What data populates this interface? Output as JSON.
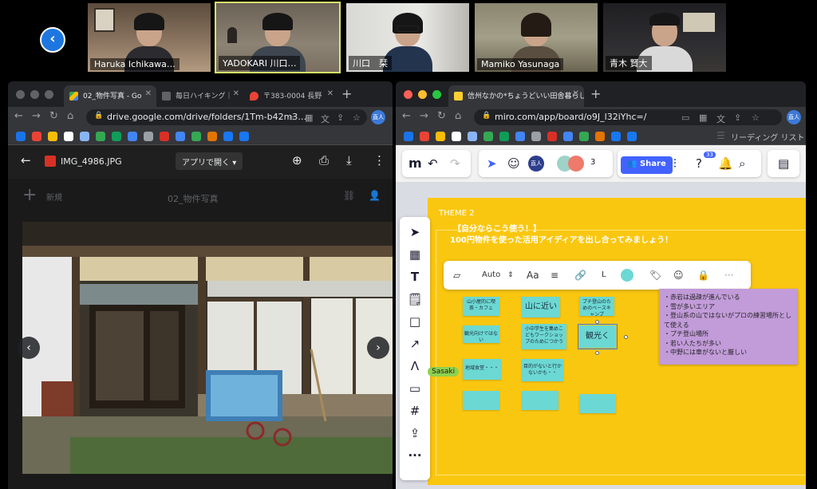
{
  "video_strip": {
    "participants": [
      {
        "name": "Haruka Ichikawa…"
      },
      {
        "name": "YADOKARI 川口…"
      },
      {
        "name": "川口　栞"
      },
      {
        "name": "Mamiko Yasunaga"
      },
      {
        "name": "青木 賢大"
      }
    ]
  },
  "drive_window": {
    "tabs": [
      {
        "label": "02_物件写真 - Go"
      },
      {
        "label": "毎日ハイキング｜"
      },
      {
        "label": "〒383-0004 長野"
      }
    ],
    "url": "drive.google.com/drive/folders/1Tm-b42m3…",
    "reading_list": "リーディング リスト",
    "file_name": "IMG_4986.JPG",
    "open_with": "アプリで開く",
    "folder_name": "02_物件写真",
    "new_label": "新規",
    "profile_initial": "直人"
  },
  "miro_window": {
    "tab": {
      "label": "信州なかの*ちょうどいい田舎暮らし"
    },
    "url": "miro.com/app/board/o9J_l32iYhc=/",
    "reading_list": "リーディング リスト",
    "profile_initial": "直人",
    "toolbar": {
      "user_chip": "直人",
      "collab_count": "3",
      "share_label": "Share",
      "notif_count": "33"
    },
    "board": {
      "theme": "THEME 2",
      "line1": "【自分ならこう使う！】",
      "line2": "100円物件を使った活用アイディアを出し合ってみましょう！"
    },
    "context_toolbar": {
      "font": "Auto",
      "text_style": "Aa",
      "size": "L"
    },
    "stickies": [
      {
        "text": "山小屋的に喫茶・カフェ"
      },
      {
        "text": "山に近い"
      },
      {
        "text": "プチ登山のためのベースキャンプ"
      },
      {
        "text": "観光向けではない"
      },
      {
        "text": "小中学生を集めこどもワークショップのためにつかう"
      },
      {
        "text": "観光く"
      },
      {
        "text": "地域食堂・・・"
      },
      {
        "text": "目的がないと行かないかも・・"
      },
      {
        "text": ""
      },
      {
        "text": ""
      },
      {
        "text": ""
      }
    ],
    "note_lines": [
      "・赤岩は過疎が進んでいる",
      "・雪が多いエリア",
      "・登山系の山ではないがプロの練習場所として使える",
      "・プチ登山場所",
      "・若い人たちが多い",
      "・中野には車がないと厳しい"
    ],
    "cursor_label": "Sasaki",
    "colors": {
      "board": "#fac710",
      "sticky": "#6cd8d3",
      "note": "#c29bd9",
      "share": "#4262ff"
    }
  }
}
